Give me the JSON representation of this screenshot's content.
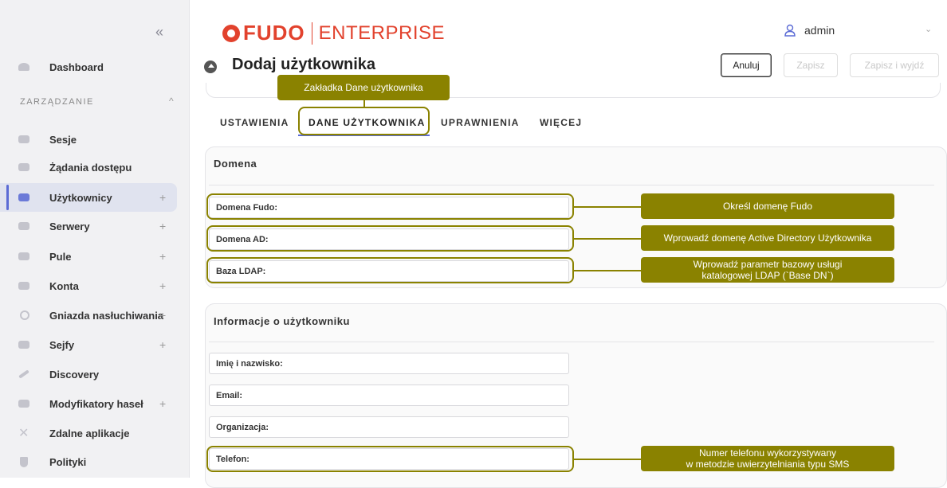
{
  "sidebar": {
    "collapse_glyph": "«",
    "section_label": "ZARZĄDZANIE",
    "section_caret": "^",
    "items": [
      {
        "label": "Dashboard",
        "icon": "dashboard-icon"
      },
      {
        "label": "Sesje",
        "icon": "sessions-icon"
      },
      {
        "label": "Żądania dostępu",
        "icon": "access-requests-icon"
      },
      {
        "label": "Użytkownicy",
        "icon": "users-icon",
        "plus": "+"
      },
      {
        "label": "Serwery",
        "icon": "servers-icon",
        "plus": "+"
      },
      {
        "label": "Pule",
        "icon": "pools-icon",
        "plus": "+"
      },
      {
        "label": "Konta",
        "icon": "accounts-icon",
        "plus": "+"
      },
      {
        "label": "Gniazda nasłuchiwania",
        "icon": "listeners-icon",
        "plus": "+"
      },
      {
        "label": "Sejfy",
        "icon": "safes-icon",
        "plus": "+"
      },
      {
        "label": "Discovery",
        "icon": "discovery-icon"
      },
      {
        "label": "Modyfikatory haseł",
        "icon": "password-changers-icon",
        "plus": "+"
      },
      {
        "label": "Zdalne aplikacje",
        "icon": "remote-apps-icon"
      },
      {
        "label": "Polityki",
        "icon": "policies-icon"
      }
    ]
  },
  "header": {
    "logo_fudo": "FUDO",
    "logo_enterprise": "ENTERPRISE",
    "user_name": "admin",
    "user_chevron": "⌄"
  },
  "page": {
    "title": "Dodaj użytkownika",
    "cancel_label": "Anuluj",
    "save_label": "Zapisz",
    "save_exit_label": "Zapisz i wyjdź"
  },
  "tabs": [
    "USTAWIENIA",
    "DANE UŻYTKOWNIKA",
    "UPRAWNIENIA",
    "WIĘCEJ"
  ],
  "domain_card": {
    "title": "Domena",
    "fields": [
      {
        "label": "Domena Fudo:",
        "value": ""
      },
      {
        "label": "Domena AD:",
        "value": ""
      },
      {
        "label": "Baza LDAP:",
        "value": ""
      }
    ]
  },
  "user_card": {
    "title": "Informacje o użytkowniku",
    "fields": [
      {
        "label": "Imię i nazwisko:",
        "value": ""
      },
      {
        "label": "Email:",
        "value": ""
      },
      {
        "label": "Organizacja:",
        "value": ""
      },
      {
        "label": "Telefon:",
        "value": ""
      }
    ]
  },
  "callouts": {
    "tab": "Zakładka Dane użytkownika",
    "fudo_domain": "Określ domenę Fudo",
    "ad_domain": "Wprowadź domenę Active Directory Użytkownika",
    "ldap_line1": "Wprowadź parametr bazowy usługi",
    "ldap_line2": "katalogowej LDAP (`Base DN`)",
    "phone_line1": "Numer telefonu wykorzystywany",
    "phone_line2": "w metodzie uwierzytelniania typu SMS"
  },
  "colors": {
    "brand": "#e2422d",
    "accent": "#5b6bd5",
    "callout": "#8a8200"
  }
}
